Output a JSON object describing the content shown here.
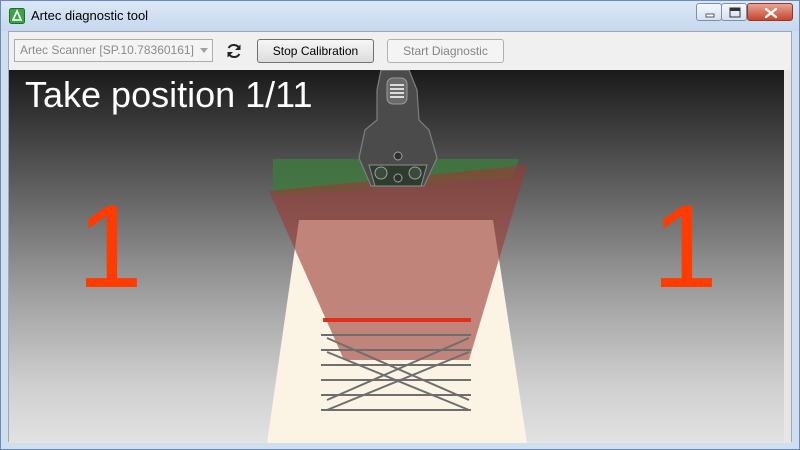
{
  "window": {
    "title": "Artec diagnostic tool",
    "icon": "artec-app-icon",
    "controls": [
      "minimize-icon",
      "maximize-icon",
      "close-icon"
    ]
  },
  "toolbar": {
    "scanner_select": {
      "value": "Artec Scanner [SP.10.78360161]",
      "enabled": false
    },
    "refresh_icon": "refresh-icon",
    "stop_calibration_label": "Stop Calibration",
    "start_diagnostic_label": "Start Diagnostic",
    "start_diagnostic_enabled": false
  },
  "viewport": {
    "prompt": "Take position 1/11",
    "left_counter": "1",
    "right_counter": "1",
    "colors": {
      "counter": "#ff3b00",
      "green_plane": "#3f7a3f",
      "red_plane": "#9a3b33",
      "target_line": "#e0301a",
      "floor_beam": "#fbf3e3"
    }
  }
}
